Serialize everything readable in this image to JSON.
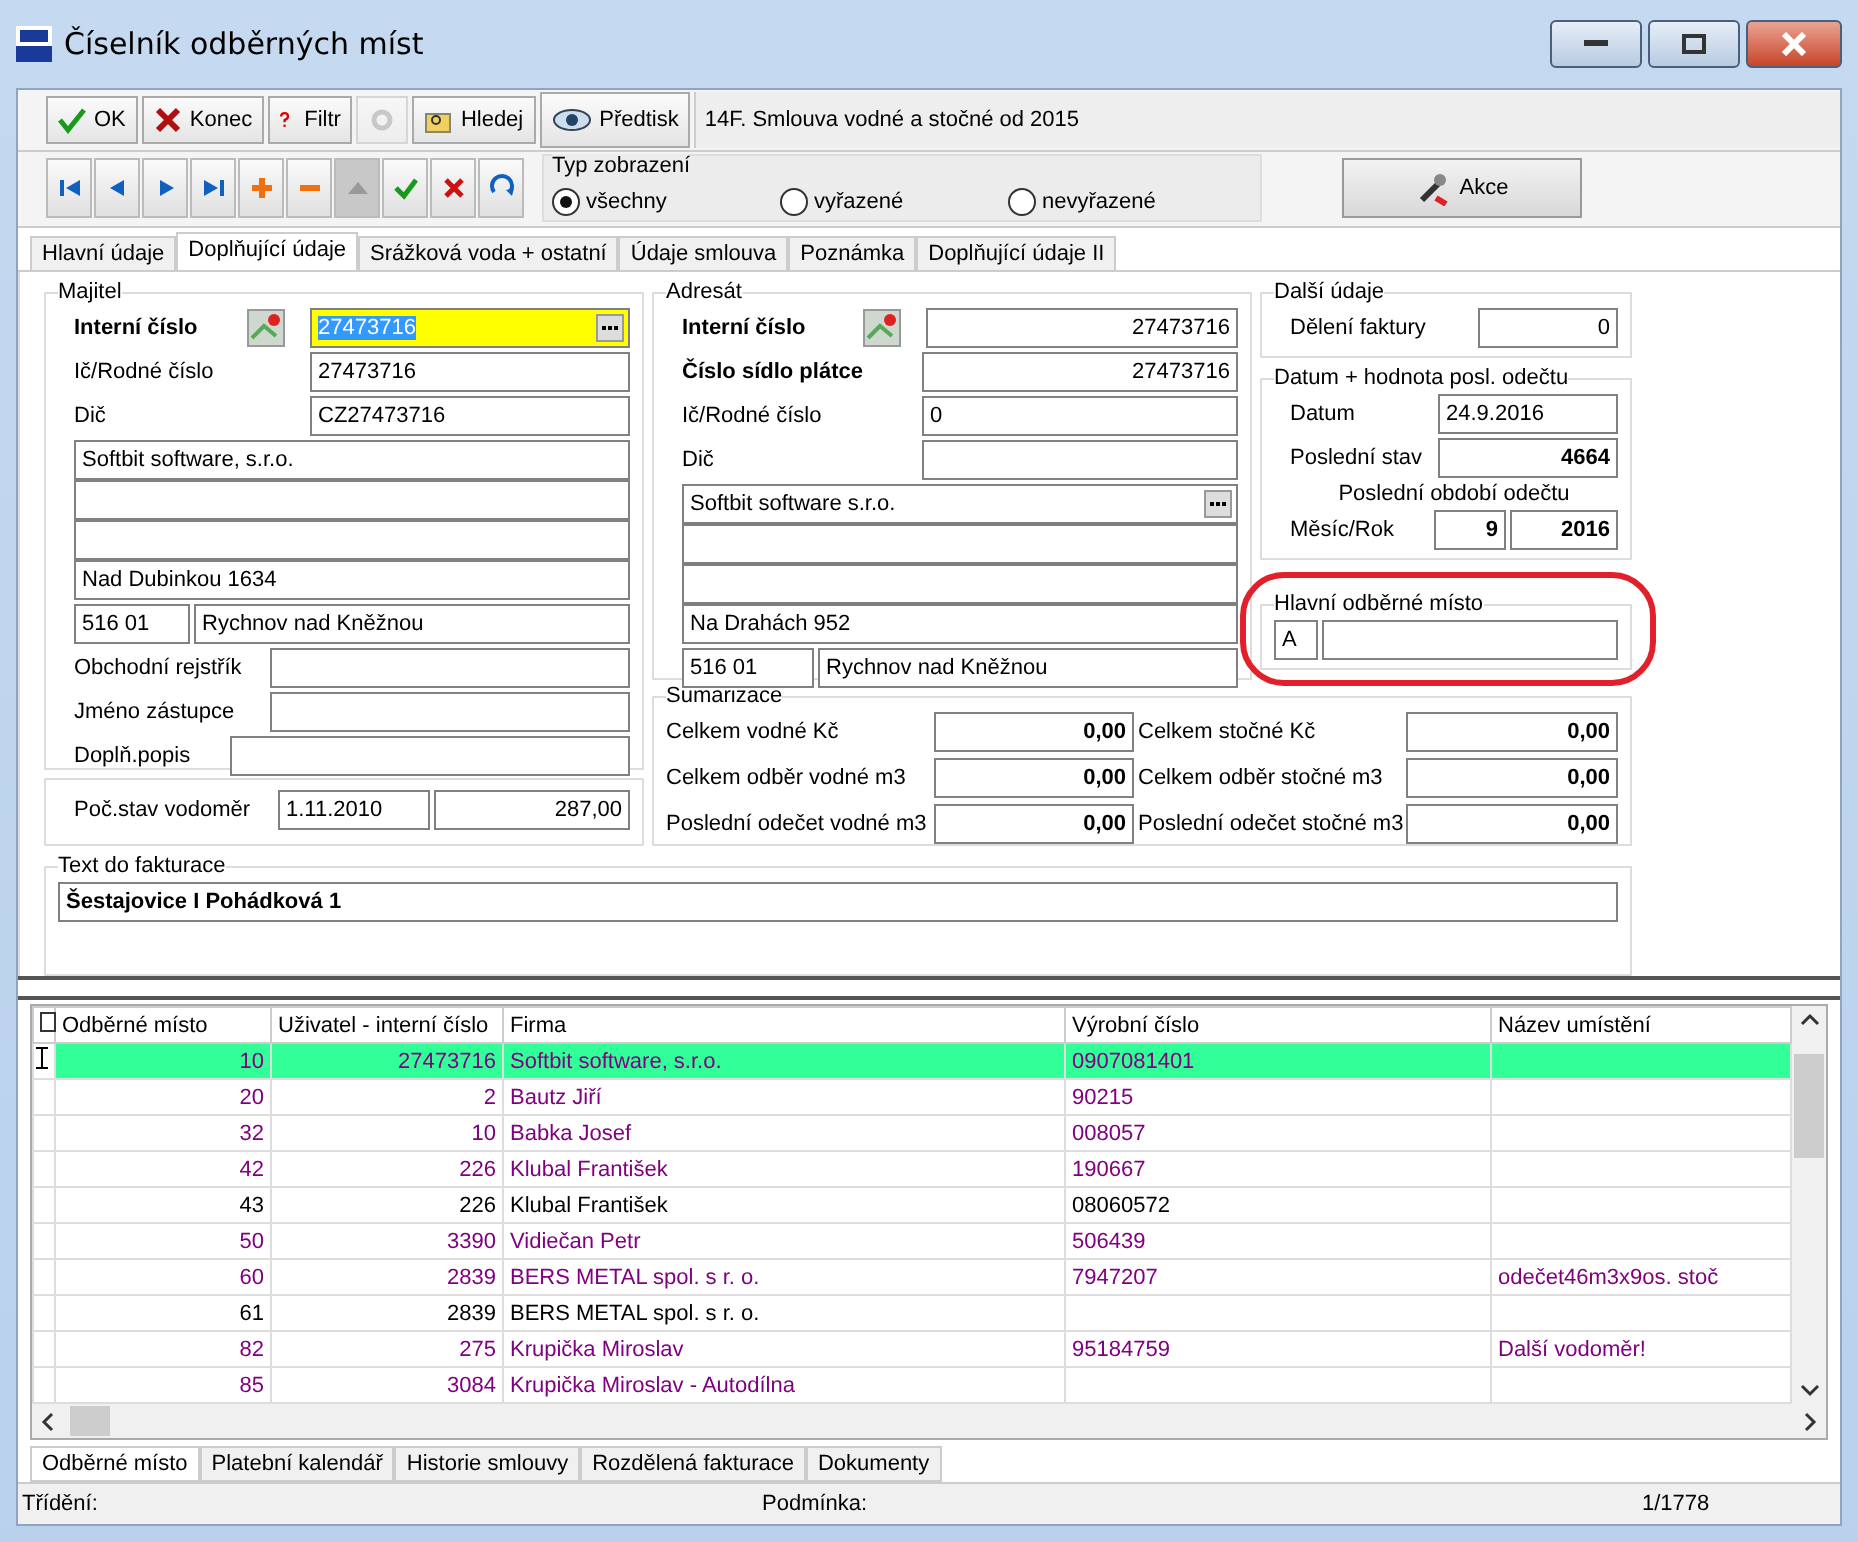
{
  "window": {
    "title": "Číselník odběrných míst"
  },
  "toolbar": [
    {
      "kind": "ok",
      "label": "OK"
    },
    {
      "kind": "close",
      "label": "Konec"
    },
    {
      "kind": "filter",
      "label": "Filtr"
    },
    {
      "kind": "tool",
      "disabled": true
    },
    {
      "kind": "find",
      "label": "Hledej"
    }
  ],
  "print_button": "Předtisk",
  "template": "14F. Smlouva vodné a stočné od 2015",
  "nav_buttons": [
    {
      "kind": "first"
    },
    {
      "kind": "prev"
    },
    {
      "kind": "next"
    },
    {
      "kind": "last"
    },
    {
      "kind": "add"
    },
    {
      "kind": "remove"
    },
    {
      "kind": "up",
      "disabled": true
    },
    {
      "kind": "confirm"
    },
    {
      "kind": "cancel"
    },
    {
      "kind": "refresh"
    }
  ],
  "view_type": {
    "label": "Typ zobrazení",
    "options": [
      {
        "label": "všechny",
        "selected": true
      },
      {
        "label": "vyřazené",
        "selected": false
      },
      {
        "label": "nevyřazené",
        "selected": false
      }
    ]
  },
  "action_button": "Akce",
  "tabs": [
    {
      "label": "Hlavní údaje",
      "selected": false
    },
    {
      "label": "Doplňující údaje",
      "selected": true
    },
    {
      "label": "Srážková voda + ostatní",
      "selected": false
    },
    {
      "label": "Údaje smlouva",
      "selected": false
    },
    {
      "label": "Poznámka",
      "selected": false
    },
    {
      "label": "Doplňující údaje II",
      "selected": false
    }
  ],
  "owner": {
    "title": "Majitel",
    "internal_label": "Interní číslo",
    "internal": "27473716",
    "id_label": "Ič/Rodné číslo",
    "id": "27473716",
    "vat_label": "Dič",
    "vat": "CZ27473716",
    "name": "Softbit software, s.r.o.",
    "street": "Nad Dubinkou 1634",
    "zip": "516 01",
    "city": "Rychnov nad Kněžnou",
    "registry_label": "Obchodní rejstřík",
    "representative_label": "Jméno zástupce",
    "note_label": "Doplň.popis"
  },
  "meter": {
    "label": "Poč.stav vodoměr",
    "date": "1.11.2010",
    "value": "287,00"
  },
  "addressee": {
    "title": "Adresát",
    "internal_label": "Interní číslo",
    "internal": "27473716",
    "payer_label": "Číslo sídlo plátce",
    "payer": "27473716",
    "id_label": "Ič/Rodné číslo",
    "id": "0",
    "vat_label": "Dič",
    "name": "Softbit software s.r.o.",
    "street": "Na Drahách 952",
    "zip": "516 01",
    "city": "Rychnov nad Kněžnou"
  },
  "other": {
    "title": "Další údaje",
    "split_label": "Dělení faktury",
    "split": "0"
  },
  "last_reading": {
    "title": "Datum + hodnota posl. odečtu",
    "date_label": "Datum",
    "date": "24.9.2016",
    "state_label": "Poslední stav",
    "state": "4664",
    "period_label": "Poslední období odečtu",
    "month_label": "Měsíc/Rok",
    "month": "9",
    "year": "2016"
  },
  "main_place": {
    "title": "Hlavní odběrné místo",
    "code": "A"
  },
  "summary": {
    "title": "Sumarizace",
    "items": [
      {
        "label": "Celkem vodné Kč",
        "value": "0,00"
      },
      {
        "label": "Celkem stočné Kč",
        "value": "0,00"
      },
      {
        "label": "Celkem odběr vodné m3",
        "value": "0,00"
      },
      {
        "label": "Celkem odběr stočné m3",
        "value": "0,00"
      },
      {
        "label": "Poslední odečet vodné m3",
        "value": "0,00"
      },
      {
        "label": "Poslední odečet stočné m3",
        "value": "0,00"
      }
    ]
  },
  "invoice_text": {
    "title": "Text do fakturace",
    "value": "Šestajovice  I Pohádková 1"
  },
  "table": {
    "columns": [
      "Odběrné místo",
      "Uživatel - interní číslo",
      "Firma",
      "Výrobní číslo",
      "Název umístění"
    ],
    "rows": [
      {
        "cells": [
          "10",
          "27473716",
          "Softbit software, s.r.o.",
          "0907081401",
          ""
        ],
        "selected": true,
        "marked": true
      },
      {
        "cells": [
          "20",
          "2",
          "Bautz Jiří",
          "90215",
          ""
        ],
        "selected": false,
        "marked": true
      },
      {
        "cells": [
          "32",
          "10",
          "Babka Josef",
          "008057",
          ""
        ],
        "selected": false,
        "marked": true
      },
      {
        "cells": [
          "42",
          "226",
          "Klubal František",
          "190667",
          ""
        ],
        "selected": false,
        "marked": true
      },
      {
        "cells": [
          "43",
          "226",
          "Klubal František",
          "08060572",
          ""
        ],
        "selected": false,
        "marked": false
      },
      {
        "cells": [
          "50",
          "3390",
          "Vidiečan Petr",
          "506439",
          ""
        ],
        "selected": false,
        "marked": true
      },
      {
        "cells": [
          "60",
          "2839",
          "BERS METAL spol. s r. o.",
          "7947207",
          "odečet46m3x9os. stoč"
        ],
        "selected": false,
        "marked": true
      },
      {
        "cells": [
          "61",
          "2839",
          "BERS METAL spol. s r. o.",
          "",
          ""
        ],
        "selected": false,
        "marked": false
      },
      {
        "cells": [
          "82",
          "275",
          "Krupička Miroslav",
          "95184759",
          "Další vodoměr!"
        ],
        "selected": false,
        "marked": true
      },
      {
        "cells": [
          "85",
          "3084",
          "Krupička Miroslav - Autodílna",
          "",
          ""
        ],
        "selected": false,
        "marked": true
      }
    ]
  },
  "bottom_tabs": [
    {
      "label": "Odběrné místo",
      "selected": true
    },
    {
      "label": "Platební kalendář",
      "selected": false
    },
    {
      "label": "Historie smlouvy",
      "selected": false
    },
    {
      "label": "Rozdělená fakturace",
      "selected": false
    },
    {
      "label": "Dokumenty",
      "selected": false
    }
  ],
  "status_bar": {
    "sort_label": "Třídění:",
    "condition_label": "Podmínka:",
    "count": "1/1778"
  }
}
